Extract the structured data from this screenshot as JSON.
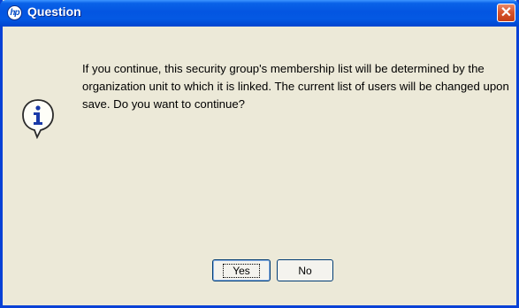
{
  "window": {
    "title": "Question",
    "logo_text": "hp",
    "close_glyph": "✕"
  },
  "dialog": {
    "icon": "info-icon",
    "message": "If you continue, this security group's membership list will be determined by the organization unit to which it is linked. The current list of users will be changed upon save. Do you want to continue?"
  },
  "buttons": {
    "yes_label": "Yes",
    "no_label": "No"
  },
  "colors": {
    "titlebar": "#0355e1",
    "dialog_bg": "#ece9d8",
    "close_button": "#d8552d",
    "button_border": "#003c74"
  }
}
